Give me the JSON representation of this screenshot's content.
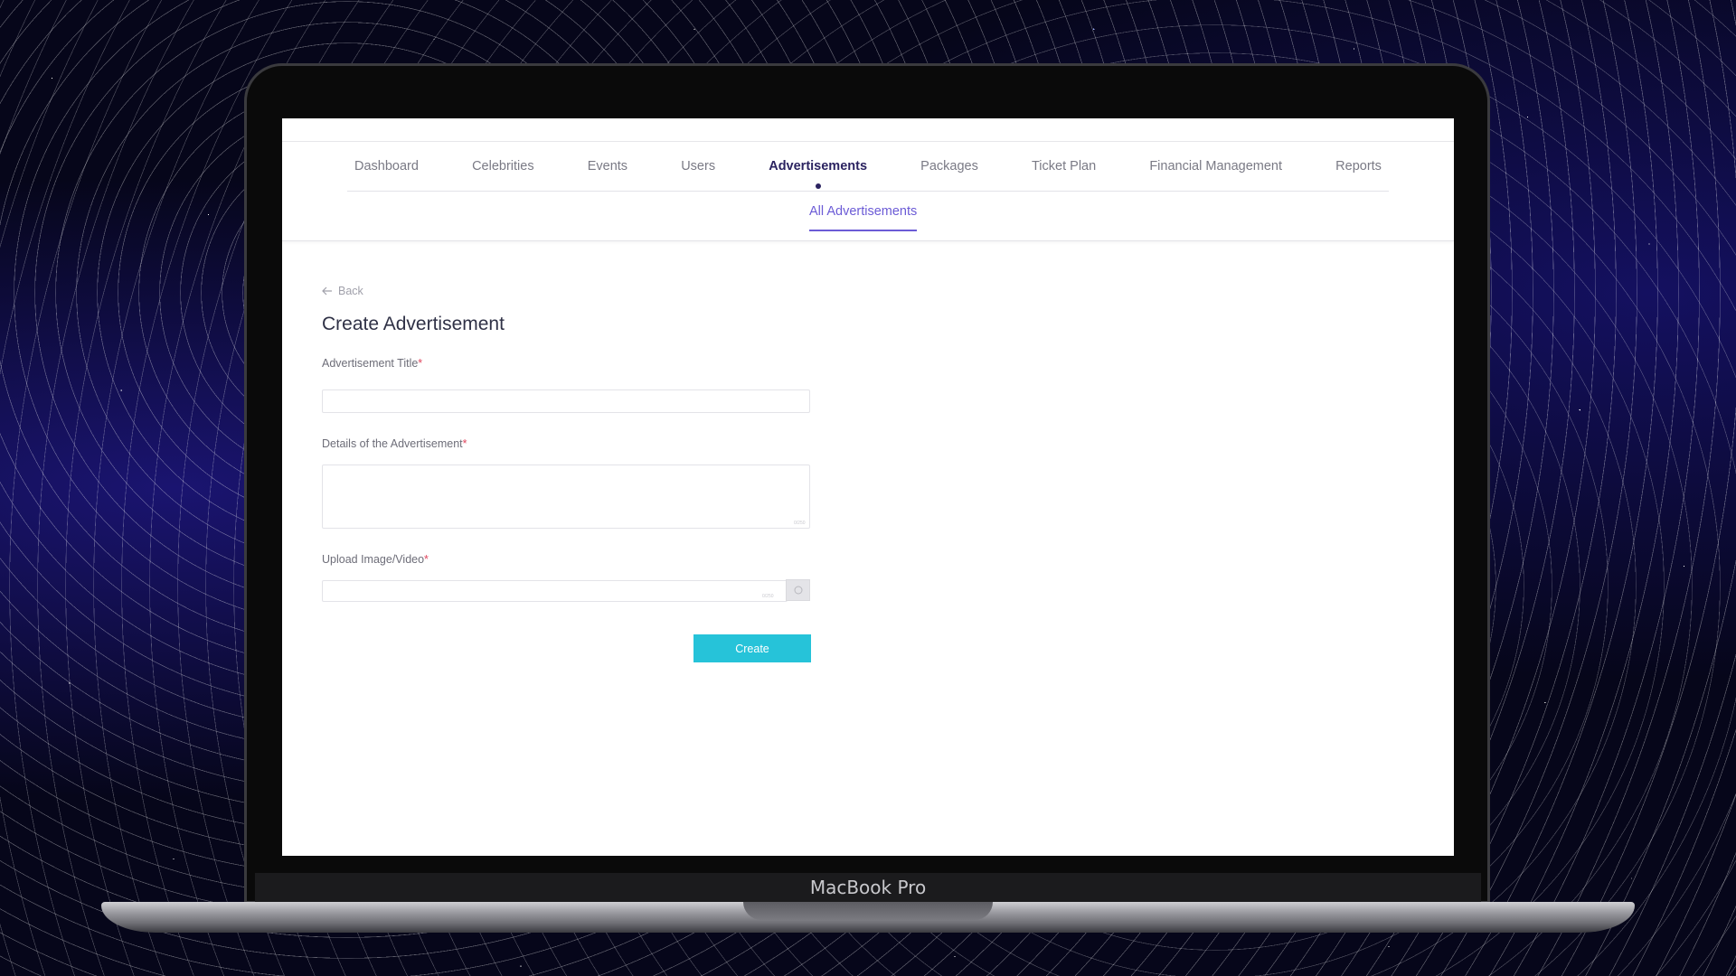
{
  "device": {
    "brand_label": "MacBook Pro"
  },
  "nav": {
    "items": [
      {
        "label": "Dashboard"
      },
      {
        "label": "Celebrities"
      },
      {
        "label": "Events"
      },
      {
        "label": "Users"
      },
      {
        "label": "Advertisements"
      },
      {
        "label": "Packages"
      },
      {
        "label": "Ticket Plan"
      },
      {
        "label": "Financial Management"
      },
      {
        "label": "Reports"
      }
    ],
    "active": "Advertisements"
  },
  "subnav": {
    "active_tab": "All Advertisements"
  },
  "page": {
    "back_label": "Back",
    "title": "Create Advertisement",
    "required_mark": "*",
    "fields": {
      "title": {
        "label": "Advertisement Title",
        "value": "",
        "placeholder": ""
      },
      "details": {
        "label": "Details of the Advertisement",
        "value": "",
        "counter": "0/250"
      },
      "upload": {
        "label": "Upload Image/Video",
        "value": "",
        "counter": "0/250"
      }
    },
    "create_label": "Create"
  },
  "colors": {
    "accent": "#6b5bd6",
    "nav_active": "#2b2360",
    "button": "#26c3d9",
    "required": "#e0465e"
  }
}
